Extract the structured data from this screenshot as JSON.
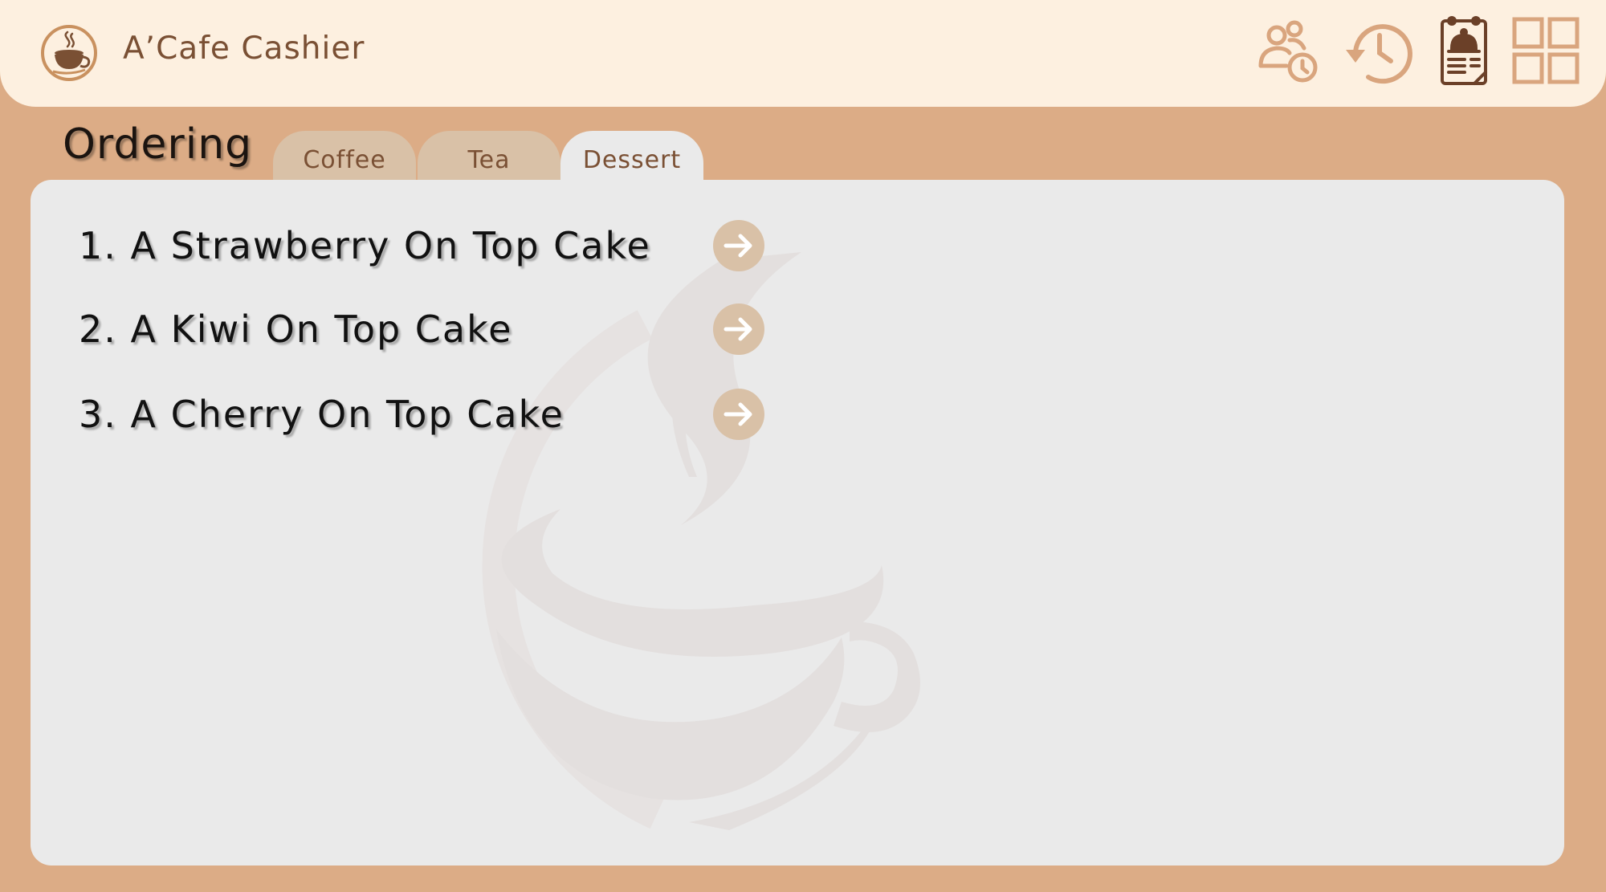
{
  "app": {
    "title": "A’Cafe Cashier",
    "logo_icon": "coffee-cup-logo-icon"
  },
  "header": {
    "icons": [
      {
        "name": "staff-shift-icon"
      },
      {
        "name": "history-icon"
      },
      {
        "name": "orders-clipboard-icon"
      },
      {
        "name": "grid-view-icon"
      }
    ]
  },
  "page": {
    "title": "Ordering"
  },
  "tabs": [
    {
      "label": "Coffee",
      "active": false
    },
    {
      "label": "Tea",
      "active": false
    },
    {
      "label": "Dessert",
      "active": true
    }
  ],
  "menu": {
    "items": [
      {
        "label": "1.  A Strawberry On Top Cake"
      },
      {
        "label": "2.  A Kiwi On Top Cake"
      },
      {
        "label": "3.  A Cherry On Top Cake"
      }
    ]
  },
  "colors": {
    "background": "#dcac86",
    "header": "#fdf0e0",
    "panel": "#eaeaea",
    "tab_inactive": "#d9c1a7",
    "brand_brown": "#7a5034",
    "icon_tan": "#d9a57e"
  }
}
